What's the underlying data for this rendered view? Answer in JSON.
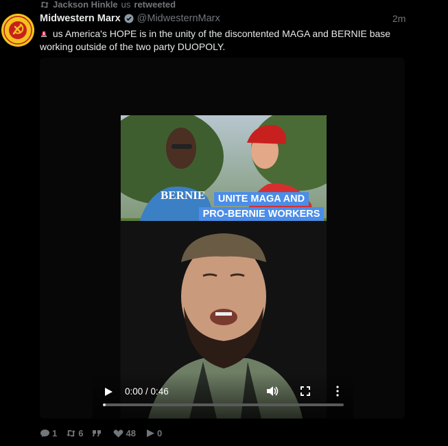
{
  "retweet_bar": {
    "text": "Jackson Hinkle",
    "flag": "us",
    "suffix": "retweeted"
  },
  "tweet": {
    "display_name": "Midwestern Marx",
    "handle": "@MidwesternMarx",
    "timestamp": "2m",
    "text_flag": "us",
    "text": "America's HOPE is in the unity of the discontented MAGA and BERNIE base working outside of the two party DUOPOLY."
  },
  "avatar_logo": {
    "top_text": "MIDWESTERN MARX",
    "bottom_text": "INSTITUTE"
  },
  "media": {
    "shirt_text": "BERNIE",
    "caption_line1": "UNITE MAGA AND",
    "caption_line2": "PRO-BERNIE WORKERS",
    "time_display": "0:00 / 0:46",
    "progress": 0.01
  },
  "actions": {
    "replies": "1",
    "retweets": "6",
    "quotes": "",
    "likes": "48",
    "views": "0"
  },
  "colors": {
    "accent": "#4b8de8",
    "avatar_bg": "#f4c21b",
    "muted": "#71767b"
  }
}
